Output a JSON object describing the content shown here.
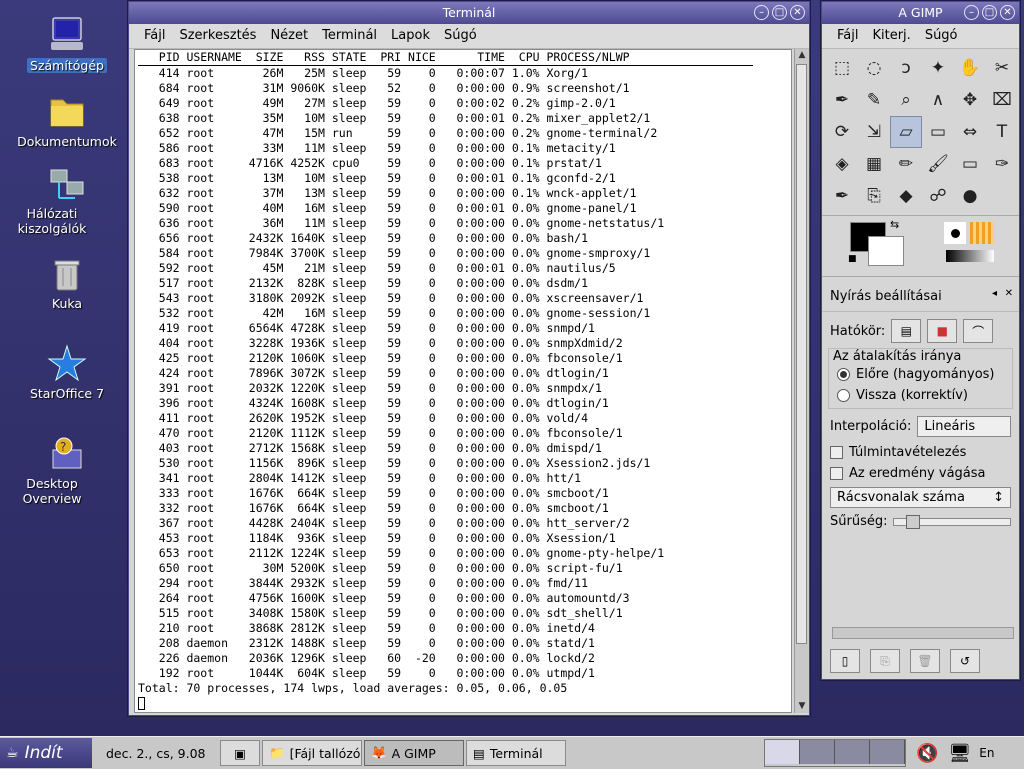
{
  "desktop_icons": [
    {
      "label": "Számítógép",
      "icon": "computer-icon"
    },
    {
      "label": "Dokumentumok",
      "icon": "folder-icon"
    },
    {
      "label": "Hálózati kiszolgálók",
      "icon": "network-icon"
    },
    {
      "label": "Kuka",
      "icon": "trash-icon"
    },
    {
      "label": "StarOffice 7",
      "icon": "staroffice-icon"
    },
    {
      "label": "Desktop Overview",
      "icon": "help-book-icon"
    }
  ],
  "terminal": {
    "title": "Terminál",
    "menu": [
      "Fájl",
      "Szerkesztés",
      "Nézet",
      "Terminál",
      "Lapok",
      "Súgó"
    ],
    "header": "   PID USERNAME  SIZE   RSS STATE  PRI NICE      TIME  CPU PROCESS/NLWP",
    "rows": [
      "   414 root       26M   25M sleep   59    0   0:00:07 1.0% Xorg/1",
      "   684 root       31M 9060K sleep   52    0   0:00:00 0.9% screenshot/1",
      "   649 root       49M   27M sleep   59    0   0:00:02 0.2% gimp-2.0/1",
      "   638 root       35M   10M sleep   59    0   0:00:01 0.2% mixer_applet2/1",
      "   652 root       47M   15M run     59    0   0:00:00 0.2% gnome-terminal/2",
      "   586 root       33M   11M sleep   59    0   0:00:00 0.1% metacity/1",
      "   683 root     4716K 4252K cpu0    59    0   0:00:00 0.1% prstat/1",
      "   538 root       13M   10M sleep   59    0   0:00:01 0.1% gconfd-2/1",
      "   632 root       37M   13M sleep   59    0   0:00:00 0.1% wnck-applet/1",
      "   590 root       40M   16M sleep   59    0   0:00:01 0.0% gnome-panel/1",
      "   636 root       36M   11M sleep   59    0   0:00:00 0.0% gnome-netstatus/1",
      "   656 root     2432K 1640K sleep   59    0   0:00:00 0.0% bash/1",
      "   584 root     7984K 3700K sleep   59    0   0:00:00 0.0% gnome-smproxy/1",
      "   592 root       45M   21M sleep   59    0   0:00:01 0.0% nautilus/5",
      "   517 root     2132K  828K sleep   59    0   0:00:00 0.0% dsdm/1",
      "   543 root     3180K 2092K sleep   59    0   0:00:00 0.0% xscreensaver/1",
      "   532 root       42M   16M sleep   59    0   0:00:00 0.0% gnome-session/1",
      "   419 root     6564K 4728K sleep   59    0   0:00:00 0.0% snmpd/1",
      "   404 root     3228K 1936K sleep   59    0   0:00:00 0.0% snmpXdmid/2",
      "   425 root     2120K 1060K sleep   59    0   0:00:00 0.0% fbconsole/1",
      "   424 root     7896K 3072K sleep   59    0   0:00:00 0.0% dtlogin/1",
      "   391 root     2032K 1220K sleep   59    0   0:00:00 0.0% snmpdx/1",
      "   396 root     4324K 1608K sleep   59    0   0:00:00 0.0% dtlogin/1",
      "   411 root     2620K 1952K sleep   59    0   0:00:00 0.0% vold/4",
      "   470 root     2120K 1112K sleep   59    0   0:00:00 0.0% fbconsole/1",
      "   403 root     2712K 1568K sleep   59    0   0:00:00 0.0% dmispd/1",
      "   530 root     1156K  896K sleep   59    0   0:00:00 0.0% Xsession2.jds/1",
      "   341 root     2804K 1412K sleep   59    0   0:00:00 0.0% htt/1",
      "   333 root     1676K  664K sleep   59    0   0:00:00 0.0% smcboot/1",
      "   332 root     1676K  664K sleep   59    0   0:00:00 0.0% smcboot/1",
      "   367 root     4428K 2404K sleep   59    0   0:00:00 0.0% htt_server/2",
      "   453 root     1184K  936K sleep   59    0   0:00:00 0.0% Xsession/1",
      "   653 root     2112K 1224K sleep   59    0   0:00:00 0.0% gnome-pty-helpe/1",
      "   650 root       30M 5200K sleep   59    0   0:00:00 0.0% script-fu/1",
      "   294 root     3844K 2932K sleep   59    0   0:00:00 0.0% fmd/11",
      "   264 root     4756K 1600K sleep   59    0   0:00:00 0.0% automountd/3",
      "   515 root     3408K 1580K sleep   59    0   0:00:00 0.0% sdt_shell/1",
      "   210 root     3868K 2812K sleep   59    0   0:00:00 0.0% inetd/4",
      "   208 daemon   2312K 1488K sleep   59    0   0:00:00 0.0% statd/1",
      "   226 daemon   2036K 1296K sleep   60  -20   0:00:00 0.0% lockd/2",
      "   192 root     1044K  604K sleep   59    0   0:00:00 0.0% utmpd/1"
    ],
    "footer": "Total: 70 processes, 174 lwps, load averages: 0.05, 0.06, 0.05"
  },
  "gimp": {
    "title": "A GIMP",
    "menu": [
      "Fájl",
      "Kiterj.",
      "Súgó"
    ],
    "tools": [
      "rect-select-icon",
      "ellipse-select-icon",
      "lasso-icon",
      "fuzzy-select-icon",
      "color-select-icon",
      "scissors-icon",
      "paths-icon",
      "color-picker-icon",
      "zoom-icon",
      "measure-icon",
      "move-icon",
      "crop-icon",
      "rotate-icon",
      "scale-icon",
      "shear-icon",
      "perspective-icon",
      "flip-icon",
      "text-icon",
      "bucket-fill-icon",
      "blend-icon",
      "pencil-icon",
      "paintbrush-icon",
      "eraser-icon",
      "airbrush-icon",
      "ink-icon",
      "clone-icon",
      "blur-icon",
      "smudge-icon",
      "dodge-burn-icon"
    ],
    "tool_glyphs": [
      "⬚",
      "◌",
      "ↄ",
      "✦",
      "✋",
      "✂",
      "✒",
      "✎",
      "⌕",
      "∧",
      "✥",
      "⌧",
      "⟳",
      "⇲",
      "▱",
      "▭",
      "⇔",
      "T",
      "◈",
      "▦",
      "✏",
      "🖌",
      "▭",
      "✑",
      "✒",
      "⎘",
      "◆",
      "☍",
      "●"
    ],
    "options": {
      "title": "Nyírás beállításai",
      "scope_label": "Hatókör:",
      "direction_label": "Az átalakítás iránya",
      "forward": "Előre (hagyományos)",
      "backward": "Vissza (korrektív)",
      "interp_label": "Interpoláció:",
      "interp_value": "Lineáris",
      "supersample": "Túlmintavételezés",
      "clip": "Az eredmény vágása",
      "grid_combo": "Rácsvonalak száma",
      "density_label": "Sűrűség:"
    }
  },
  "taskbar": {
    "start": "Indít",
    "clock": "dec. 2., cs,  9.08",
    "tasks": [
      {
        "label": "[Fájl tallózó: /",
        "icon": "folder-icon",
        "active": false
      },
      {
        "label": "A GIMP",
        "icon": "gimp-icon",
        "active": true
      },
      {
        "label": "Terminál",
        "icon": "terminal-icon",
        "active": false
      }
    ],
    "lang": "En"
  }
}
